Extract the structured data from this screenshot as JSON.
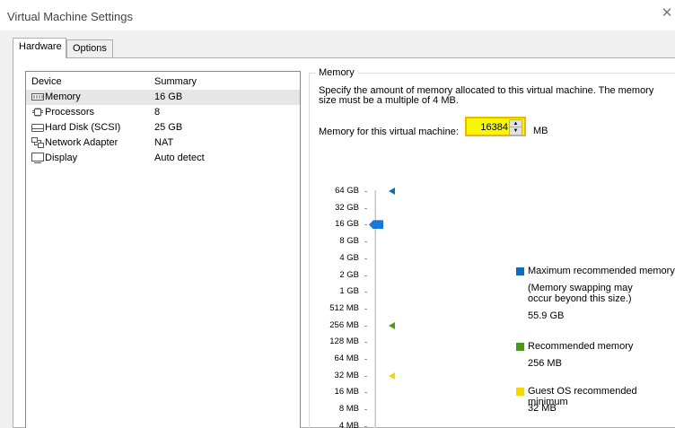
{
  "window": {
    "title": "Virtual Machine Settings"
  },
  "tabs": [
    {
      "label": "Hardware"
    },
    {
      "label": "Options"
    }
  ],
  "device_list": {
    "headers": {
      "device": "Device",
      "summary": "Summary"
    },
    "rows": [
      {
        "icon": "memory-icon",
        "name": "Memory",
        "summary": "16 GB",
        "selected": true
      },
      {
        "icon": "processor-icon",
        "name": "Processors",
        "summary": "8"
      },
      {
        "icon": "hard-disk-icon",
        "name": "Hard Disk (SCSI)",
        "summary": "25 GB"
      },
      {
        "icon": "network-adapter-icon",
        "name": "Network Adapter",
        "summary": "NAT"
      },
      {
        "icon": "display-icon",
        "name": "Display",
        "summary": "Auto detect"
      }
    ]
  },
  "memory": {
    "group_title": "Memory",
    "description": "Specify the amount of memory allocated to this virtual machine. The memory size must be a multiple of 4 MB.",
    "field_label": "Memory for this virtual machine:",
    "value": "16384",
    "unit": "MB",
    "slider_current": "16 GB",
    "scale_labels": [
      "64 GB",
      "32 GB",
      "16 GB",
      "8 GB",
      "4 GB",
      "2 GB",
      "1 GB",
      "512 MB",
      "256 MB",
      "128 MB",
      "64 MB",
      "32 MB",
      "16 MB",
      "8 MB",
      "4 MB"
    ],
    "markers": {
      "maximum": "64 GB",
      "recommended": "256 MB",
      "guest_min": "32 MB"
    },
    "legend": {
      "max_title": "Maximum recommended memory",
      "max_note1": "(Memory swapping may",
      "max_note2": "occur beyond this size.)",
      "max_value": "55.9 GB",
      "rec_title": "Recommended memory",
      "rec_value": "256 MB",
      "min_title": "Guest OS recommended minimum",
      "min_value": "32 MB"
    },
    "colors": {
      "maximum": "#0f6cbd",
      "recommended": "#4a9a1a",
      "guest_min": "#f5d800",
      "thumb": "#1879d8"
    }
  }
}
